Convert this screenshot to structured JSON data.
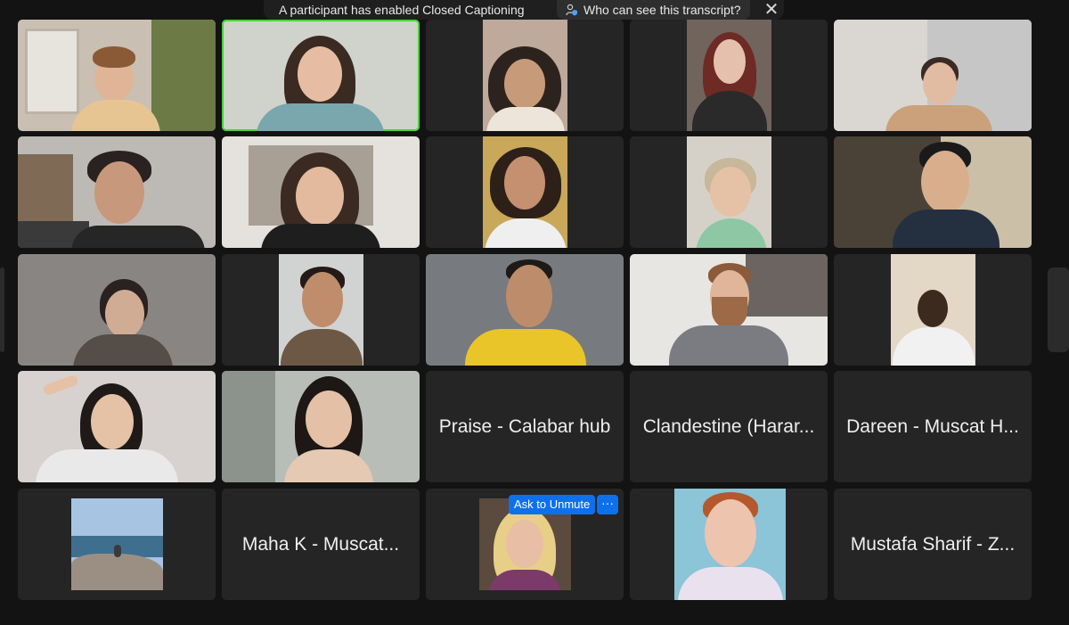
{
  "banner": {
    "message": "A participant has enabled Closed Captioning",
    "who_label": "Who can see this transcript?",
    "close_icon": "close-icon",
    "who_icon": "person-shield-icon"
  },
  "participants": [
    {
      "name": "Praise - Calabar hub"
    },
    {
      "name": "Clandestine (Harar..."
    },
    {
      "name": "Dareen - Muscat H..."
    },
    {
      "name": "Maha K - Muscat..."
    },
    {
      "name": "Mustafa Sharif - Z..."
    }
  ],
  "tile_controls": {
    "ask_to_unmute": "Ask to Unmute",
    "more_label": "···"
  },
  "colors": {
    "background": "#131313",
    "tile": "#252525",
    "active_speaker": "#4cd137",
    "accent": "#0e71eb"
  }
}
